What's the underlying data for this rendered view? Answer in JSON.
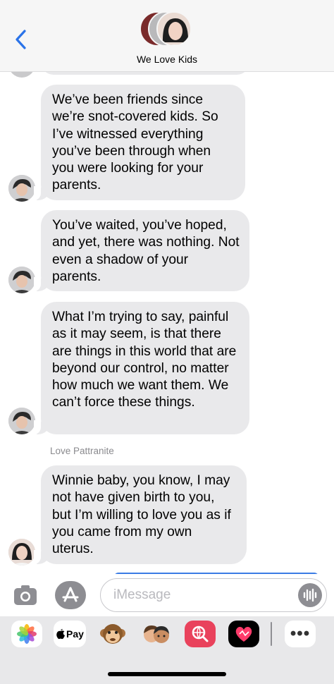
{
  "header": {
    "group_name": "We Love Kids",
    "back_icon": "chevron-left-icon"
  },
  "messages": [
    {
      "text": "We’ve been friends since we’re snot-covered kids. So I’ve witnessed everything you’ve been through when you were looking for your parents."
    },
    {
      "text": "You’ve waited, you’ve hoped, and yet, there was nothing. Not even a shadow of your parents."
    },
    {
      "text": "What I’m trying to say, painful as it may seem, is that there are things in this world that are beyond our control, no matter how much we want them. We can’t force these things."
    },
    {
      "sender": "Love Pattranite",
      "text": "Winnie baby, you know, I may not have given birth to you, but I’m willing to love you as if  you came from my own uterus."
    }
  ],
  "input": {
    "placeholder": "iMessage",
    "value": ""
  },
  "drawer": {
    "apple_pay_label": "Pay",
    "more_label": "•••"
  },
  "colors": {
    "bubble_gray": "#e9e9eb",
    "accent_blue": "#3a7be4",
    "back_blue": "#2a73e8"
  }
}
